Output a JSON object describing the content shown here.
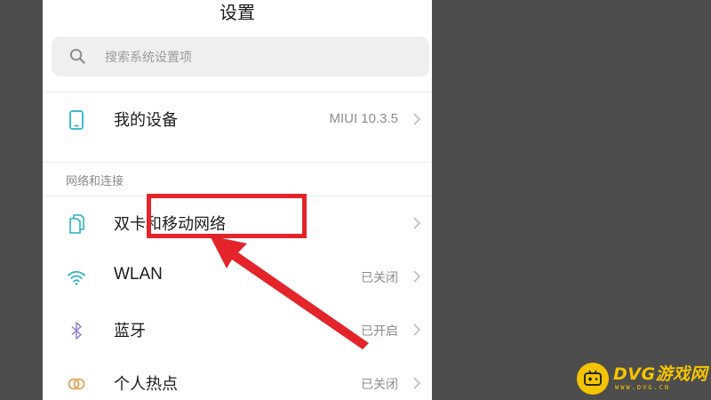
{
  "app": {
    "title": "设置"
  },
  "search": {
    "placeholder": "搜索系统设置项"
  },
  "my_device": {
    "label": "我的设备",
    "value": "MIUI 10.3.5"
  },
  "section": {
    "network_header": "网络和连接"
  },
  "network_items": [
    {
      "label": "双卡和移动网络",
      "value": "",
      "icon": "sim-card-icon"
    },
    {
      "label": "WLAN",
      "value": "已关闭",
      "icon": "wifi-icon"
    },
    {
      "label": "蓝牙",
      "value": "已开启",
      "icon": "bluetooth-icon"
    },
    {
      "label": "个人热点",
      "value": "已关闭",
      "icon": "hotspot-icon"
    }
  ],
  "watermark": {
    "text": "DVG游戏网",
    "url": "WWW.DVG.CN"
  },
  "colors": {
    "highlight": "#e4242b",
    "icon_accent": "#2bb3c0",
    "watermark": "#f5c400"
  }
}
